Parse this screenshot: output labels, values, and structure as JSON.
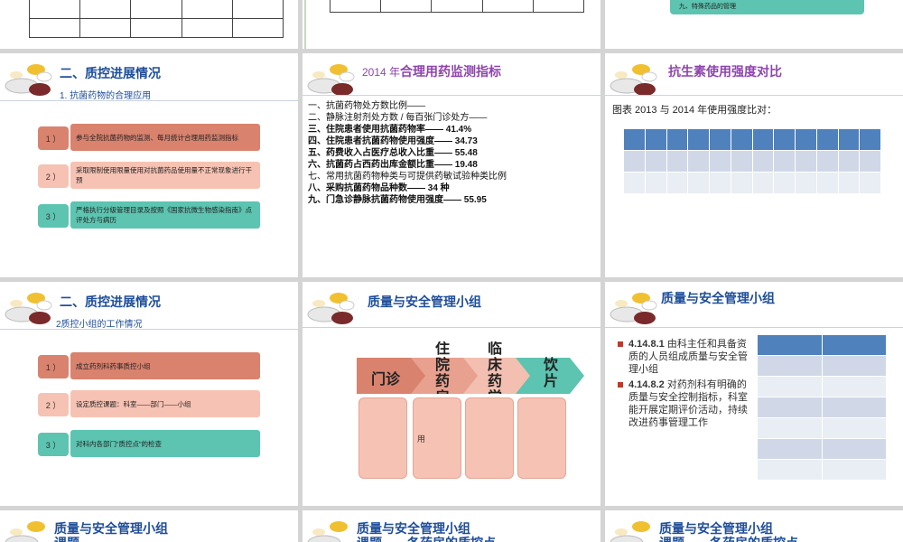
{
  "row1": {
    "green_box_text": "九、特殊药品的管理"
  },
  "slide4": {
    "title": "二、质控进展情况",
    "subtitle": "1. 抗菌药物的合理应用",
    "items": [
      {
        "num": "1 ）",
        "text": "参与全院抗菌药物的监测、每月统计合理用药监测指标"
      },
      {
        "num": "2 ）",
        "text": "采取限制使用限量使用对抗菌药品使用量不正常现象进行干预"
      },
      {
        "num": "3 ）",
        "text": "严格执行分级管理目录及按照《国家抗微生物感染指南》点评处方与病历"
      }
    ]
  },
  "slide5": {
    "title_year": "2014 年",
    "title_rest": "合理用药监测指标",
    "lines": [
      "一、抗菌药物处方数比例——",
      "二、静脉注射剂处方数 / 每百张门诊处方——",
      "三、住院患者使用抗菌药物率—— 41.4%",
      "四、住院患者抗菌药物使用强度—— 34.73",
      "五、药费收入占医疗总收入比重—— 55.48",
      "六、抗菌药占西药出库金额比重—— 19.48",
      "七、常用抗菌药物种类与可提供药敏试验种类比例",
      "八、采购抗菌药物品种数—— 34 种",
      "九、门急诊静脉抗菌药物使用强度—— 55.95"
    ]
  },
  "slide6": {
    "title": "抗生素使用强度对比",
    "caption": "图表 2013 与 2014 年使用强度比对："
  },
  "slide7": {
    "title": "二、质控进展情况",
    "subtitle": "2质控小组的工作情况",
    "items": [
      {
        "num": "1 ）",
        "text": "成立药剂科药事质控小组"
      },
      {
        "num": "2 ）",
        "text": "设定质控课题：科室——部门——小组"
      },
      {
        "num": "3 ）",
        "text": "对科内各部门“质控点”的检查"
      }
    ]
  },
  "slide8": {
    "title": "质量与安全管理小组",
    "chevrons": [
      "门诊",
      "住\n院\n药\n房",
      "临\n床\n药\n学",
      "饮\n片"
    ],
    "box_text": "用"
  },
  "slide9": {
    "title": "质量与安全管理小组",
    "bullets": [
      {
        "code": "4.14.8.1",
        "text": " 由科主任和具备资质的人员组成质量与安全管理小组"
      },
      {
        "code": "4.14.8.2",
        "text": " 对药剂科有明确的质量与安全控制指标，科室能开展定期评价活动，持续改进药事管理工作"
      }
    ]
  },
  "row4": [
    {
      "title": "质量与安全管理小组",
      "sub": "课题"
    },
    {
      "title": "质量与安全管理小组",
      "sub": "课题——各药房的质控点"
    },
    {
      "title": "质量与安全管理小组",
      "sub": "课题——各药房的质控点"
    }
  ]
}
